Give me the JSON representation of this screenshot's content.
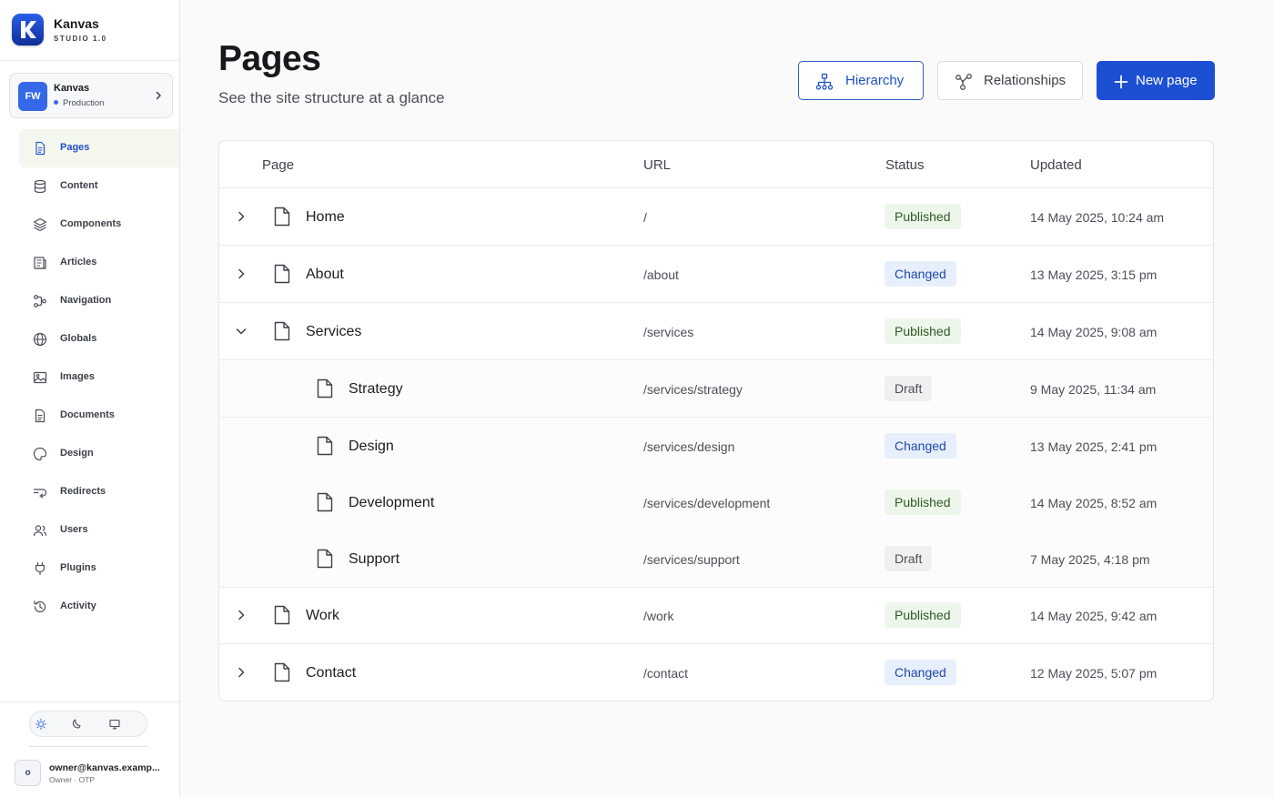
{
  "app": {
    "name": "Kanvas",
    "version": "STUDIO 1.0"
  },
  "workspace": {
    "initials": "FW",
    "name": "Kanvas",
    "environment": "Production"
  },
  "sidebar": {
    "items": [
      {
        "label": "Pages",
        "icon": "pages-icon",
        "active": true
      },
      {
        "label": "Content",
        "icon": "database-icon"
      },
      {
        "label": "Components",
        "icon": "layers-icon"
      },
      {
        "label": "Articles",
        "icon": "articles-icon"
      },
      {
        "label": "Navigation",
        "icon": "navigation-icon"
      },
      {
        "label": "Globals",
        "icon": "globe-icon"
      },
      {
        "label": "Images",
        "icon": "image-icon"
      },
      {
        "label": "Documents",
        "icon": "document-icon"
      },
      {
        "label": "Design",
        "icon": "palette-icon"
      },
      {
        "label": "Redirects",
        "icon": "redirect-icon"
      },
      {
        "label": "Users",
        "icon": "users-icon"
      },
      {
        "label": "Plugins",
        "icon": "plug-icon"
      },
      {
        "label": "Activity",
        "icon": "history-icon"
      }
    ]
  },
  "theme": {
    "options": [
      "light",
      "dark",
      "system"
    ],
    "selected": "light"
  },
  "user": {
    "initial": "o",
    "email": "owner@kanvas.examp...",
    "role": "Owner · OTP"
  },
  "header": {
    "title": "Pages",
    "subtitle": "See the site structure at a glance",
    "hierarchy_label": "Hierarchy",
    "relationships_label": "Relationships",
    "new_page_label": "New page"
  },
  "table": {
    "columns": [
      "Page",
      "URL",
      "Status",
      "Updated"
    ],
    "rows": [
      {
        "name": "Home",
        "url": "/",
        "status": "Published",
        "updated": "14 May 2025, 10:24 am",
        "level": 0,
        "expanded": false
      },
      {
        "name": "About",
        "url": "/about",
        "status": "Changed",
        "updated": "13 May 2025, 3:15 pm",
        "level": 0,
        "expanded": false
      },
      {
        "name": "Services",
        "url": "/services",
        "status": "Published",
        "updated": "14 May 2025, 9:08 am",
        "level": 0,
        "expanded": true
      },
      {
        "name": "Strategy",
        "url": "/services/strategy",
        "status": "Draft",
        "updated": "9 May 2025, 11:34 am",
        "level": 1
      },
      {
        "name": "Design",
        "url": "/services/design",
        "status": "Changed",
        "updated": "13 May 2025, 2:41 pm",
        "level": 1
      },
      {
        "name": "Development",
        "url": "/services/development",
        "status": "Published",
        "updated": "14 May 2025, 8:52 am",
        "level": 1
      },
      {
        "name": "Support",
        "url": "/services/support",
        "status": "Draft",
        "updated": "7 May 2025, 4:18 pm",
        "level": 1
      },
      {
        "name": "Work",
        "url": "/work",
        "status": "Published",
        "updated": "14 May 2025, 9:42 am",
        "level": 0,
        "expanded": false
      },
      {
        "name": "Contact",
        "url": "/contact",
        "status": "Changed",
        "updated": "12 May 2025, 5:07 pm",
        "level": 0,
        "expanded": false
      }
    ]
  },
  "colors": {
    "accent": "#1d4fd3",
    "published_bg": "#edf6ea",
    "changed_bg": "#e7effd",
    "draft_bg": "#f0f0f1"
  }
}
